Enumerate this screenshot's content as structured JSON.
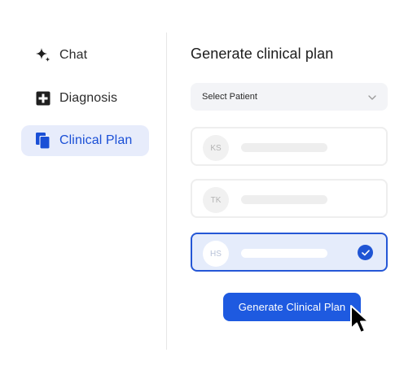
{
  "sidebar": {
    "items": [
      {
        "label": "Chat",
        "icon": "sparkle-icon",
        "active": false
      },
      {
        "label": "Diagnosis",
        "icon": "medical-plus-icon",
        "active": false
      },
      {
        "label": "Clinical Plan",
        "icon": "copy-documents-icon",
        "active": true
      }
    ]
  },
  "main": {
    "title": "Generate clinical plan",
    "select": {
      "label": "Select Patient",
      "icon": "chevron-down-icon"
    },
    "patients": [
      {
        "initials": "KS",
        "selected": false
      },
      {
        "initials": "TK",
        "selected": false
      },
      {
        "initials": "HS",
        "selected": true,
        "icon": "check-circle-icon"
      }
    ],
    "generate_button": {
      "label": "Generate Clinical Plan"
    }
  },
  "colors": {
    "accent": "#1e5ae0",
    "active_nav_bg": "#e7ecfb",
    "active_nav_text": "#1a4fd6",
    "selected_card_bg": "#e5ecfb",
    "selected_card_border": "#2557d6"
  }
}
